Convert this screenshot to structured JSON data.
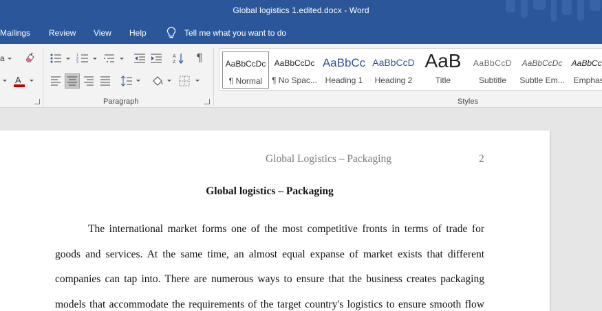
{
  "window": {
    "title": "Global logistics 1.edited.docx  -  Word"
  },
  "menu": {
    "tabs": [
      "Mailings",
      "Review",
      "View",
      "Help"
    ],
    "tell_me": "Tell me what you want to do"
  },
  "ribbon": {
    "groups": {
      "paragraph": "Paragraph",
      "styles": "Styles"
    },
    "font_partial_label": "a",
    "font_color": "#c00000",
    "styles": [
      {
        "sample": "AaBbCcDc",
        "name": "¶ Normal"
      },
      {
        "sample": "AaBbCcDc",
        "name": "¶ No Spac..."
      },
      {
        "sample": "AaBbCc",
        "name": "Heading 1"
      },
      {
        "sample": "AaBbCcD",
        "name": "Heading 2"
      },
      {
        "sample": "AaB",
        "name": "Title"
      },
      {
        "sample": "AaBbCcD",
        "name": "Subtitle"
      },
      {
        "sample": "AaBbCcDc",
        "name": "Subtle Em..."
      },
      {
        "sample": "AaBbCcDc",
        "name": "Emphasis"
      }
    ]
  },
  "document": {
    "header": "Global Logistics – Packaging",
    "page_number": "2",
    "title": "Global logistics – Packaging",
    "lines": [
      "The international market forms one of the most competitive fronts in terms of trade for",
      "goods and services. At the same time, an almost equal expanse of market exists that different",
      "companies can tap into. There are numerous ways to ensure that the business creates packaging",
      "models that accommodate the requirements of the target country's logistics to ensure smooth flow"
    ]
  },
  "colors": {
    "word_blue": "#2b579a",
    "ribbon_bg": "#f3f3f3",
    "canvas_bg": "#e6e6e6"
  }
}
